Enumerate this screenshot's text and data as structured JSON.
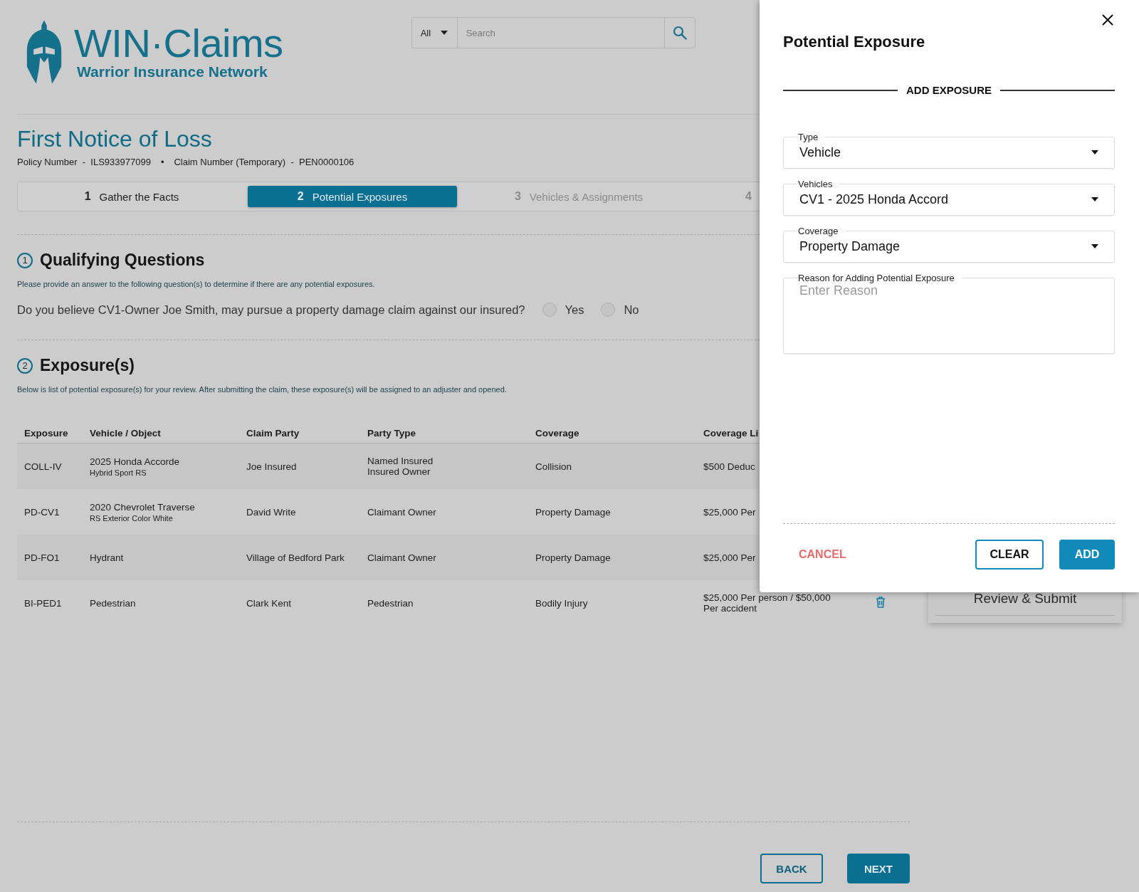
{
  "logo": {
    "title": "WIN·Claims",
    "subtitle": "Warrior Insurance Network"
  },
  "search": {
    "scope": "All",
    "placeholder": "Search"
  },
  "page": {
    "title": "First Notice of Loss",
    "meta": [
      "Policy Number  -  ILS933977099",
      "Claim Number (Temporary)  -  PEN0000106"
    ],
    "meta_separator": "•"
  },
  "steps": [
    {
      "number": "1",
      "label": "Gather the Facts",
      "selected": false,
      "disabled": false
    },
    {
      "number": "2",
      "label": "Potential Exposures",
      "selected": true,
      "disabled": false
    },
    {
      "number": "3",
      "label": "Vehicles & Assignments",
      "selected": false,
      "disabled": true
    },
    {
      "number": "4",
      "selected": false,
      "disabled": true
    }
  ],
  "qualifying": {
    "number": "1",
    "title": "Qualifying Questions",
    "description": "Please provide an answer to the following question(s) to determine if there are any potential exposures.",
    "question": "Do you believe CV1-Owner Joe Smith, may pursue a property damage claim against our insured?",
    "options": [
      {
        "label": "Yes",
        "selected": false
      },
      {
        "label": "No",
        "selected": false
      }
    ]
  },
  "exposures": {
    "number": "2",
    "title": "Exposure(s)",
    "description": "Below is list of potential exposure(s) for your review. After submitting the claim, these exposure(s) will be assigned to an adjuster and opened.",
    "columns": [
      "Exposure",
      "Vehicle / Object",
      "Claim Party",
      "Party Type",
      "Coverage",
      "Coverage Li"
    ],
    "rows": [
      {
        "exposure": "COLL-IV",
        "vehicle": "2025 Honda Accorde",
        "vehicle_detail": "Hybrid Sport RS",
        "claim_party": "Joe Insured",
        "party_type": [
          "Named Insured",
          "Insured Owner"
        ],
        "coverage": "Collision",
        "coverage_limit": "$500 Deduc",
        "delete": false
      },
      {
        "exposure": "PD-CV1",
        "vehicle": "2020 Chevrolet Traverse",
        "vehicle_detail": "RS Exterior Color White",
        "claim_party": "David Write",
        "party_type": [
          "Claimant Owner"
        ],
        "coverage": "Property Damage",
        "coverage_limit": "$25,000 Per",
        "delete": false
      },
      {
        "exposure": "PD-FO1",
        "vehicle": "Hydrant",
        "claim_party": "Village of Bedford Park",
        "party_type": [
          "Claimant Owner"
        ],
        "coverage": "Property Damage",
        "coverage_limit": "$25,000 Per",
        "delete": false
      },
      {
        "exposure": "BI-PED1",
        "vehicle": "Pedestrian",
        "claim_party": "Clark Kent",
        "party_type": [
          "Pedestrian"
        ],
        "coverage": "Bodily Injury",
        "coverage_limit": "$25,000 Per person / $50,000 Per accident",
        "delete": true
      }
    ]
  },
  "footer_buttons": [
    {
      "label": "BACK",
      "kind": "outline"
    },
    {
      "label": "NEXT",
      "kind": "primary"
    }
  ],
  "side_card": {
    "label": "Review & Submit"
  },
  "panel": {
    "title": "Potential Exposure",
    "section": "ADD EXPOSURE",
    "fields": [
      {
        "kind": "select",
        "label": "Type",
        "value": "Vehicle"
      },
      {
        "kind": "select",
        "label": "Vehicles",
        "value": "CV1 - 2025 Honda Accord"
      },
      {
        "kind": "select",
        "label": "Coverage",
        "value": "Property Damage"
      },
      {
        "kind": "textarea",
        "label": "Reason for Adding Potential Exposure",
        "placeholder": "Enter Reason"
      }
    ],
    "buttons": [
      {
        "label": "CANCEL",
        "kind": "text"
      },
      {
        "label": "CLEAR",
        "kind": "outline"
      },
      {
        "label": "ADD",
        "kind": "primary"
      }
    ]
  }
}
